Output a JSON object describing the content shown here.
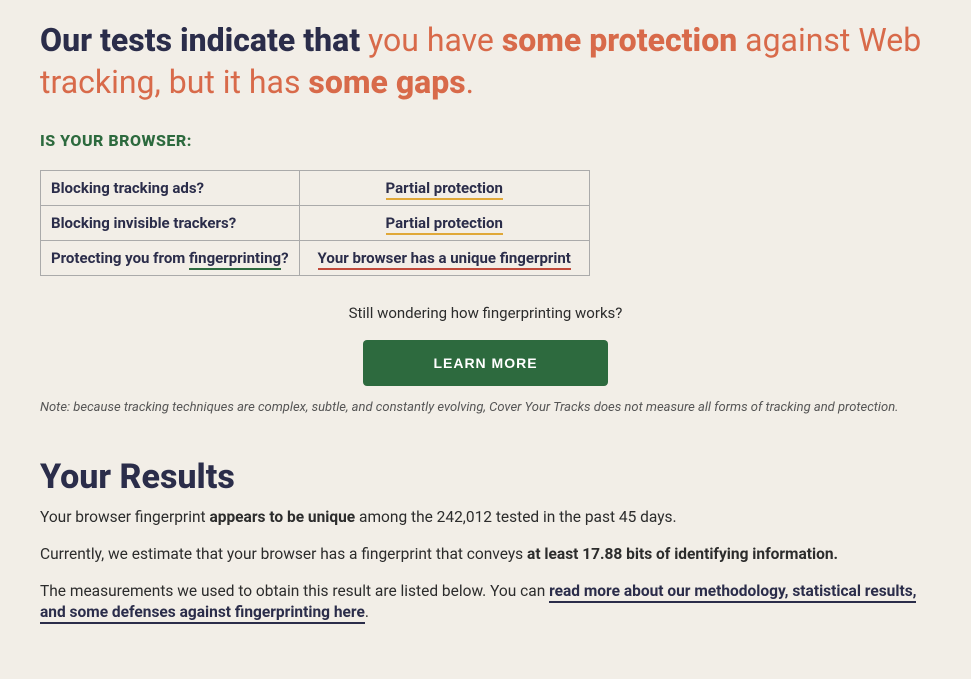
{
  "headline": {
    "part1": "Our tests indicate that ",
    "part2": "you have ",
    "part3": "some protection",
    "part4": " against Web tracking, but it has ",
    "part5": "some gaps",
    "part6": "."
  },
  "sub_heading": "IS YOUR BROWSER:",
  "table": {
    "rows": [
      {
        "label": "Blocking tracking ads?",
        "value": "Partial protection",
        "style": "yellow"
      },
      {
        "label": "Blocking invisible trackers?",
        "value": "Partial protection",
        "style": "yellow"
      },
      {
        "label_pre": "Protecting you from ",
        "label_link": "fingerprinting",
        "label_post": "?",
        "value": "Your browser has a unique fingerprint",
        "style": "red"
      }
    ]
  },
  "wondering": "Still wondering how fingerprinting works?",
  "learn_more": "LEARN MORE",
  "note": "Note: because tracking techniques are complex, subtle, and constantly evolving, Cover Your Tracks does not measure all forms of tracking and protection.",
  "results": {
    "title": "Your Results",
    "p1_a": "Your browser fingerprint ",
    "p1_b": "appears to be unique",
    "p1_c": " among the 242,012 tested in the past 45 days.",
    "p2_a": "Currently, we estimate that your browser has a fingerprint that conveys ",
    "p2_b": "at least 17.88 bits of identifying information.",
    "p3_a": "The measurements we used to obtain this result are listed below. You can ",
    "p3_link": "read more about our methodology, statistical results, and some defenses against fingerprinting here",
    "p3_b": "."
  }
}
